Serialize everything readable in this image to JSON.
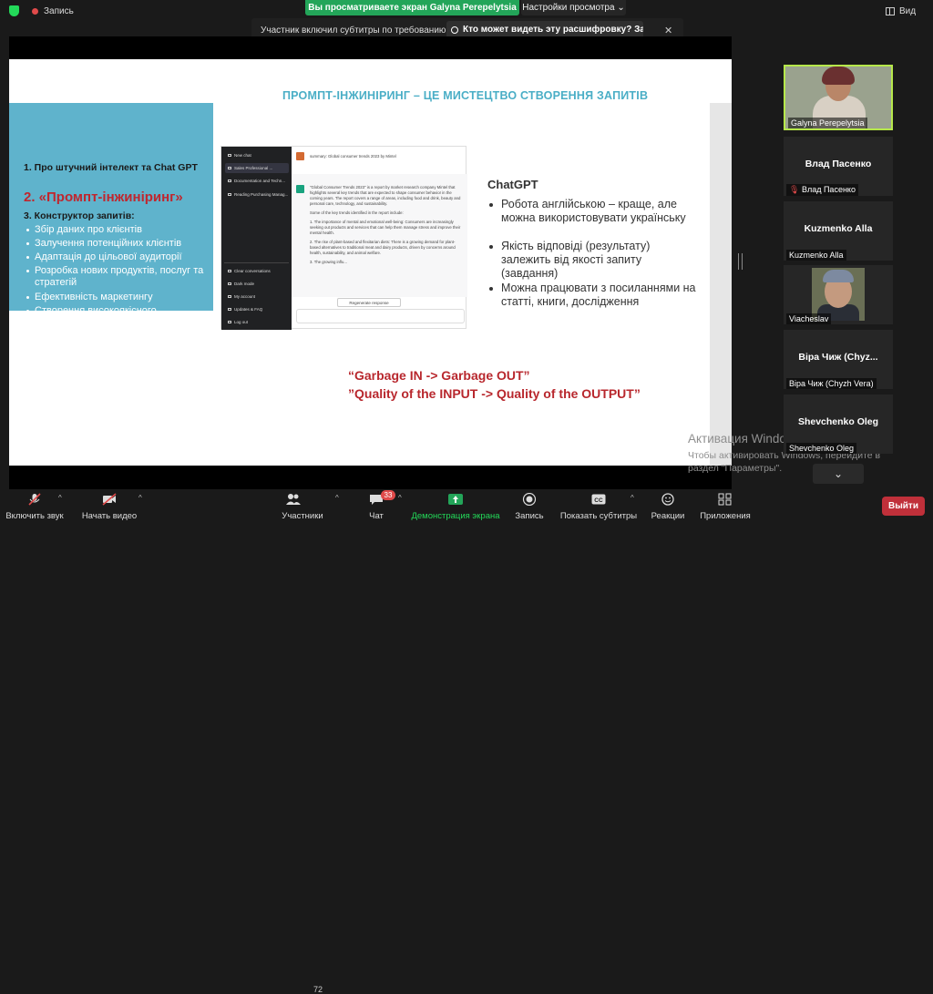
{
  "topbar": {
    "recording_label": "Запись",
    "viewing_banner": "Вы просматриваете экран Galyna Perepelytsia",
    "view_options": "Настройки просмотра",
    "view_button": "Вид",
    "accent_color": "#23a559"
  },
  "caption_notice": {
    "text": "Участник включил субтитры по требованию",
    "button": "Кто может видеть эту расшифровку? За..."
  },
  "slide": {
    "title": "ПРОМПТ-ІНЖИНІРИНГ – ЦЕ МИСТЕЦТВО СТВОРЕННЯ ЗАПИТІВ",
    "left_panel": {
      "item1": "1. Про штучний інтелект та Chat GPT",
      "item2": "2.  «Промпт-інжиніринг»",
      "item3": "3. Конструктор запитів:",
      "bullets": [
        "Збір даних про клієнтів",
        "Залучення потенційних клієнтів",
        "Адаптація до цільової аудиторії",
        "Розробка нових продуктів, послуг та стратегій",
        "Ефективність маркетингу",
        "Створення високоякісного контенту"
      ]
    },
    "chatgpt_mock": {
      "sidebar": [
        "New chat",
        "Sales Professional ...",
        "Documentation and Techn...",
        "Reading Purchasing Manag...",
        "Clear conversations",
        "Dark mode",
        "My account",
        "Updates & FAQ",
        "Log out"
      ],
      "question": "summary: Global consumer trends 2023 by Mintel",
      "answer": [
        "\"Global Consumer Trends 2023\" is a report by market research company Mintel that highlights several key trends that are expected to shape consumer behavior in the coming years. The report covers a range of areas, including food and drink, beauty and personal care, technology, and sustainability.",
        "Some of the key trends identified in the report include:",
        "1. The importance of mental and emotional well-being: Consumers are increasingly seeking out products and services that can help them manage stress and improve their mental health.",
        "2. The rise of plant-based and flexitarian diets: There is a growing demand for plant-based alternatives to traditional meat and dairy products, driven by concerns around health, sustainability, and animal welfare.",
        "3. The growing influ..."
      ],
      "regenerate": "Regenerate response"
    },
    "chatgpt_title": "ChatGPT",
    "chatgpt_points": [
      "Робота англійською – краще, але можна  використовувати українську",
      "Якість відповіді (результату) залежить від якості запиту (завдання)",
      "Можна працювати з посиланнями на статті, книги, дослідження"
    ],
    "garbage_line1": "“Garbage IN -> Garbage OUT”",
    "garbage_line2": "”Quality of the INPUT -> Quality of the OUTPUT”"
  },
  "windows_activation": {
    "title": "Активация Windows",
    "text": "Чтобы активировать Windows, перейдите в раздел \"Параметры\"."
  },
  "participants": [
    {
      "name": "Galyna Perepelytsia",
      "video": true
    },
    {
      "display": "Влад Пасенко",
      "label": "Влад Пасенко",
      "muted": true
    },
    {
      "display": "Kuzmenko Alla",
      "label": "Kuzmenko Alla"
    },
    {
      "label": "Viacheslav",
      "video": true
    },
    {
      "display": "Віра Чиж  (Chyz...",
      "label": "Віра Чиж (Chyzh Vera)"
    },
    {
      "display": "Shevchenko Oleg",
      "label": "Shevchenko Oleg"
    }
  ],
  "toolbar": {
    "mute": "Включить звук",
    "video": "Начать видео",
    "participants": "Участники",
    "participants_count": "72",
    "chat": "Чат",
    "chat_badge": "33",
    "share": "Демонстрация экрана",
    "record": "Запись",
    "captions": "Показать субтитры",
    "reactions": "Реакции",
    "apps": "Приложения",
    "leave": "Выйти",
    "leave_color": "#c0303a"
  }
}
